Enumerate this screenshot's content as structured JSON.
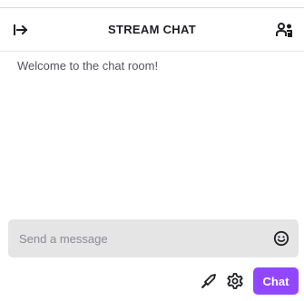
{
  "header": {
    "title": "STREAM CHAT",
    "collapse_icon": "collapse-arrow-icon",
    "users_icon": "community-users-icon"
  },
  "chat": {
    "welcome_message": "Welcome to the chat room!"
  },
  "composer": {
    "placeholder": "Send a message",
    "value": "",
    "emoji_icon": "smiley-emoji-icon",
    "bits_icon": "sword-bits-icon",
    "settings_icon": "gear-icon",
    "send_label": "Chat"
  },
  "colors": {
    "accent": "#9147ff",
    "input_background": "#e5e5e5",
    "text_primary": "#1f1f23",
    "text_secondary": "#53535f"
  }
}
